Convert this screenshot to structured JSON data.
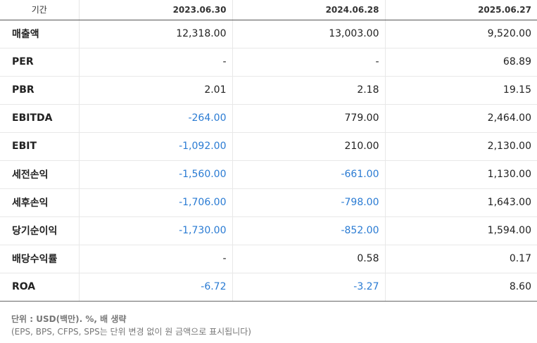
{
  "header": {
    "label": "기간",
    "periods": [
      "2023.06.30",
      "2024.06.28",
      "2025.06.27"
    ]
  },
  "rows": [
    {
      "label": "매출액",
      "values": [
        "12,318.00",
        "13,003.00",
        "9,520.00"
      ],
      "neg": [
        false,
        false,
        false
      ]
    },
    {
      "label": "PER",
      "values": [
        "-",
        "-",
        "68.89"
      ],
      "neg": [
        false,
        false,
        false
      ]
    },
    {
      "label": "PBR",
      "values": [
        "2.01",
        "2.18",
        "19.15"
      ],
      "neg": [
        false,
        false,
        false
      ]
    },
    {
      "label": "EBITDA",
      "values": [
        "-264.00",
        "779.00",
        "2,464.00"
      ],
      "neg": [
        true,
        false,
        false
      ]
    },
    {
      "label": "EBIT",
      "values": [
        "-1,092.00",
        "210.00",
        "2,130.00"
      ],
      "neg": [
        true,
        false,
        false
      ]
    },
    {
      "label": "세전손익",
      "values": [
        "-1,560.00",
        "-661.00",
        "1,130.00"
      ],
      "neg": [
        true,
        true,
        false
      ]
    },
    {
      "label": "세후손익",
      "values": [
        "-1,706.00",
        "-798.00",
        "1,643.00"
      ],
      "neg": [
        true,
        true,
        false
      ]
    },
    {
      "label": "당기순이익",
      "values": [
        "-1,730.00",
        "-852.00",
        "1,594.00"
      ],
      "neg": [
        true,
        true,
        false
      ]
    },
    {
      "label": "배당수익률",
      "values": [
        "-",
        "0.58",
        "0.17"
      ],
      "neg": [
        false,
        false,
        false
      ]
    },
    {
      "label": "ROA",
      "values": [
        "-6.72",
        "-3.27",
        "8.60"
      ],
      "neg": [
        true,
        true,
        false
      ]
    }
  ],
  "notes": {
    "unit": "단위 : USD(백만). %, 배 생략",
    "detail": "(EPS, BPS, CFPS, SPS는 단위 변경 없이 원 금액으로 표시됩니다)"
  },
  "colors": {
    "negative": "#2a7bd3",
    "text": "#222222"
  }
}
